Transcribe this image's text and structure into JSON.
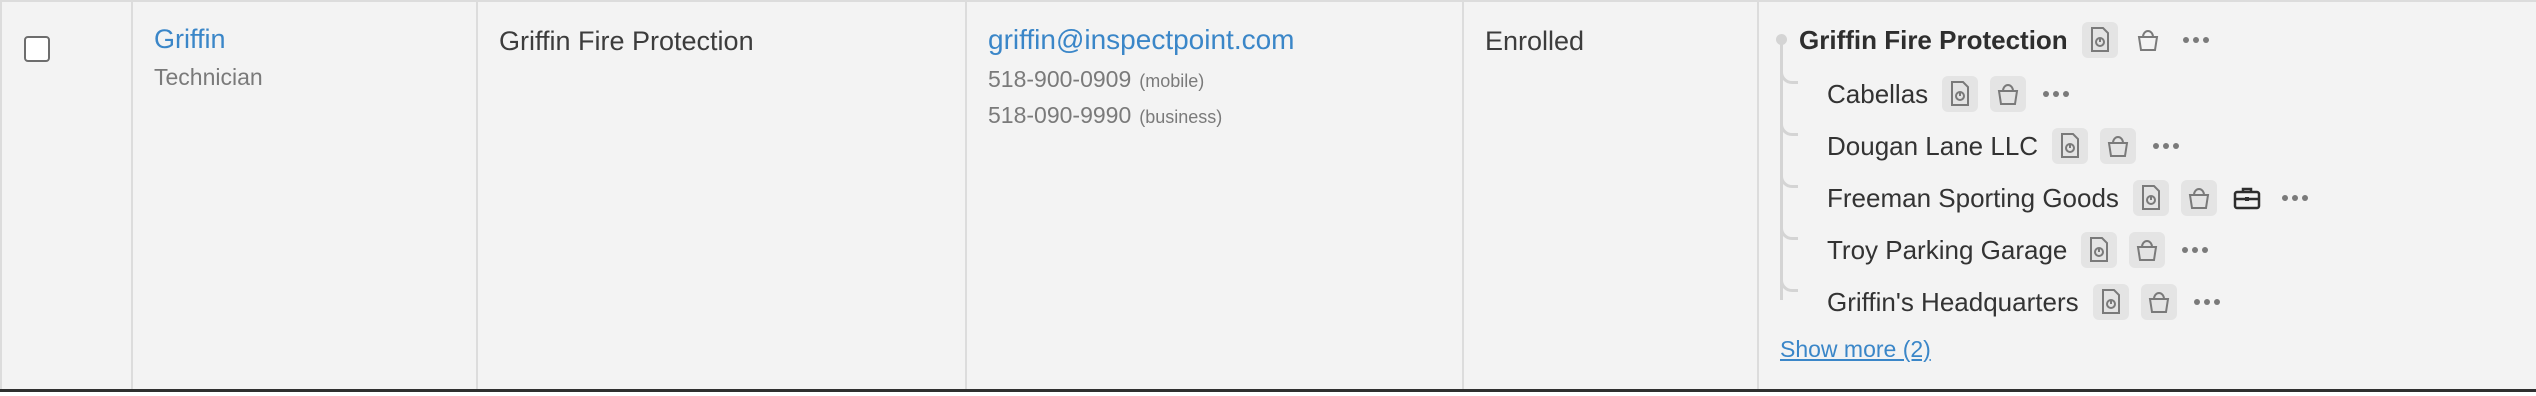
{
  "contact": {
    "name": "Griffin",
    "role": "Technician",
    "company": "Griffin Fire Protection",
    "email": "griffin@inspectpoint.com",
    "phones": [
      {
        "number": "518-900-0909",
        "type": "(mobile)"
      },
      {
        "number": "518-090-9990",
        "type": "(business)"
      }
    ],
    "status": "Enrolled"
  },
  "tree": {
    "root": {
      "label": "Griffin Fire Protection",
      "icons": [
        "report-icon",
        "bucket-icon",
        "more-icon"
      ]
    },
    "children": [
      {
        "label": "Cabellas",
        "icons": [
          "report-icon",
          "bucket-icon",
          "more-icon"
        ]
      },
      {
        "label": "Dougan Lane LLC",
        "icons": [
          "report-icon",
          "bucket-icon",
          "more-icon"
        ]
      },
      {
        "label": "Freeman Sporting Goods",
        "icons": [
          "report-icon",
          "bucket-icon",
          "briefcase-icon",
          "more-icon"
        ]
      },
      {
        "label": "Troy Parking Garage",
        "icons": [
          "report-icon",
          "bucket-icon",
          "more-icon"
        ]
      },
      {
        "label": "Griffin's Headquarters",
        "icons": [
          "report-icon",
          "bucket-icon",
          "more-icon"
        ]
      }
    ],
    "show_more": "Show more (2)"
  },
  "colors": {
    "link": "#3a86c8",
    "row_bg": "#f3f3f3",
    "icon_bg": "#e4e4e4"
  }
}
